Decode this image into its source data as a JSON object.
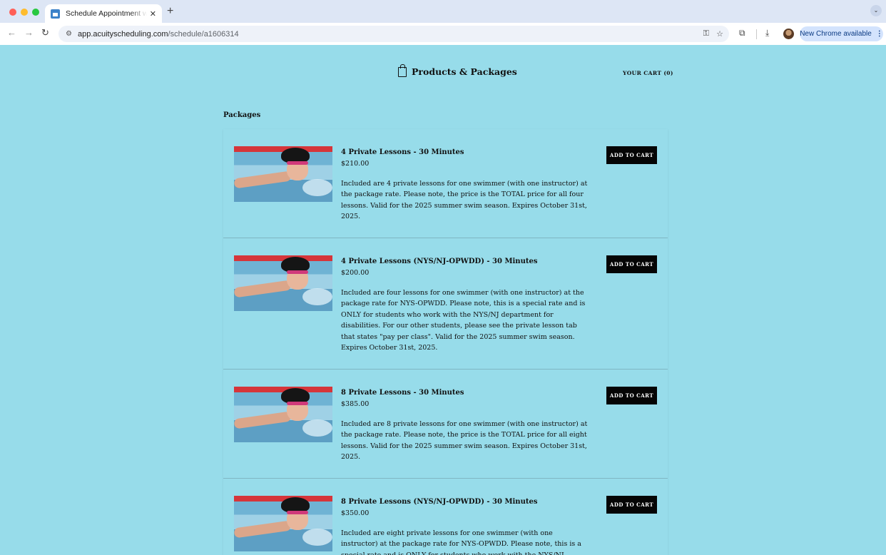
{
  "browser": {
    "tab_title": "Schedule Appointment with S",
    "tab_close": "✕",
    "new_tab": "+",
    "tab_menu": "⌄",
    "back": "←",
    "forward": "→",
    "reload": "↻",
    "site_info": "⚙",
    "url_host": "app.acuityscheduling.com",
    "url_path": "/schedule/a1606314",
    "key_icon": "⚿",
    "star_icon": "☆",
    "ext_icon": "⧉",
    "download_icon": "⤓",
    "update_label": "New Chrome available",
    "update_menu": "⋮"
  },
  "header": {
    "title": "Products & Packages",
    "cart_label": "YOUR CART (0)"
  },
  "section_title": "Packages",
  "button_label": "ADD TO CART",
  "packages": [
    {
      "name": "4 Private Lessons - 30 Minutes",
      "price": "$210.00",
      "description": "Included are 4 private lessons for one swimmer (with one instructor) at the package rate. Please note, the price is the TOTAL price for all four lessons. Valid for the 2025 summer swim season. Expires October 31st, 2025."
    },
    {
      "name": "4 Private Lessons (NYS/NJ-OPWDD) - 30 Minutes",
      "price": "$200.00",
      "description": "Included are four lessons for one swimmer (with one instructor) at the package rate for NYS-OPWDD. Please note, this is a special rate and is ONLY for students who work with the NYS/NJ department for disabilities. For our other students, please see the private lesson tab that states \"pay per class\". Valid for the 2025 summer swim season. Expires October 31st, 2025."
    },
    {
      "name": "8 Private Lessons - 30 Minutes",
      "price": "$385.00",
      "description": "Included are 8 private lessons for one swimmer (with one instructor) at the package rate. Please note, the price is the TOTAL price for all eight lessons. Valid for the 2025 summer swim season. Expires October 31st, 2025."
    },
    {
      "name": "8 Private Lessons (NYS/NJ-OPWDD) - 30 Minutes",
      "price": "$350.00",
      "description": "Included are eight private lessons for one swimmer (with one instructor) at the package rate for NYS-OPWDD. Please note, this is a special rate and is ONLY for students who work with the NYS/NJ department for"
    }
  ]
}
